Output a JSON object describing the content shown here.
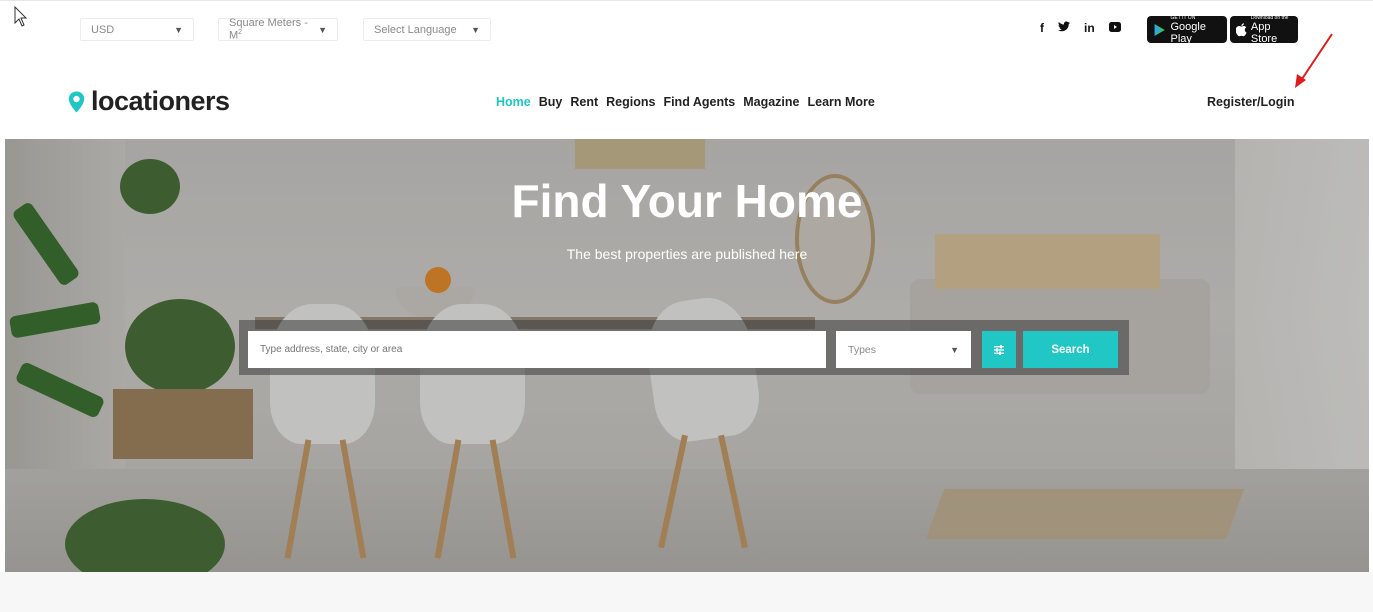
{
  "topbar": {
    "currency": "USD",
    "unit_parts": [
      "Square Meters - M",
      "2"
    ],
    "language_placeholder": "Select Language",
    "social": [
      "f",
      "y",
      "in",
      "yt"
    ],
    "google_play": {
      "small": "GET IT ON",
      "big": "Google Play"
    },
    "app_store": {
      "small": "Download on the",
      "big": "App Store"
    }
  },
  "brand": {
    "name": "locationers",
    "accent": "#1ec7c4"
  },
  "nav": {
    "items": [
      "Home",
      "Buy",
      "Rent",
      "Regions",
      "Find Agents",
      "Magazine",
      "Learn More"
    ],
    "active": "Home",
    "login": "Register/Login"
  },
  "hero": {
    "title": "Find Your Home",
    "subtitle": "The best properties are published here",
    "search_placeholder": "Type address, state, city or area",
    "types_label": "Types",
    "search_button": "Search"
  },
  "annotation_color": "#e01b1b"
}
